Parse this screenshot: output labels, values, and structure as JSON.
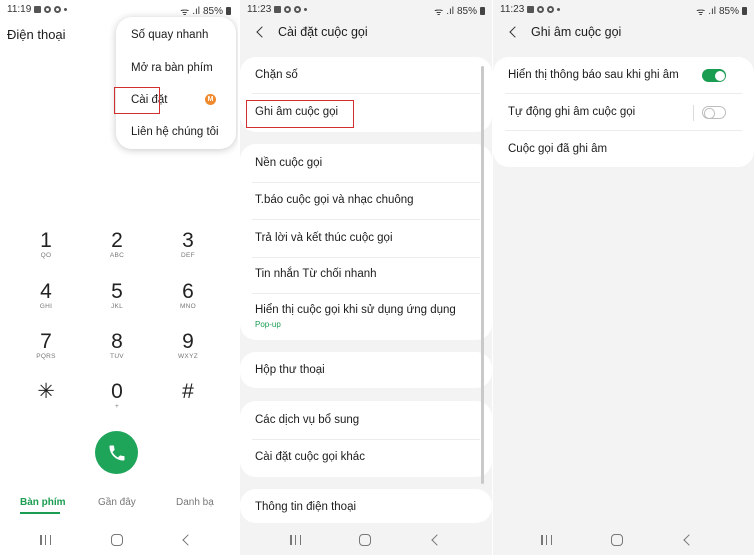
{
  "dialer": {
    "status": {
      "time": "11:19",
      "battery": "85%"
    },
    "title": "Điện thoại",
    "menu": {
      "items": [
        "Số quay nhanh",
        "Mở ra bàn phím",
        "Cài đặt",
        "Liên hệ chúng tôi"
      ],
      "badge": "M",
      "highlighted": "Cài đặt"
    },
    "keypad": [
      {
        "digit": "1",
        "letters": "QO"
      },
      {
        "digit": "2",
        "letters": "ABC"
      },
      {
        "digit": "3",
        "letters": "DEF"
      },
      {
        "digit": "4",
        "letters": "GHI"
      },
      {
        "digit": "5",
        "letters": "JKL"
      },
      {
        "digit": "6",
        "letters": "MNO"
      },
      {
        "digit": "7",
        "letters": "PQRS"
      },
      {
        "digit": "8",
        "letters": "TUV"
      },
      {
        "digit": "9",
        "letters": "WXYZ"
      },
      {
        "digit": "✳",
        "letters": ""
      },
      {
        "digit": "0",
        "letters": "+"
      },
      {
        "digit": "#",
        "letters": ""
      }
    ],
    "tabs": [
      "Bàn phím",
      "Gần đây",
      "Danh bạ"
    ],
    "active_tab": "Bàn phím"
  },
  "call_settings": {
    "status": {
      "time": "11:23",
      "battery": "85%"
    },
    "title": "Cài đặt cuộc gọi",
    "groups": [
      [
        "Chặn số",
        "Ghi âm cuộc gọi"
      ],
      [
        "Nền cuộc gọi",
        "T.báo cuộc gọi và nhạc chuông",
        "Trả lời và kết thúc cuộc gọi",
        "Tin nhắn Từ chối nhanh",
        "Hiển thị cuộc gọi khi sử dụng ứng dụng"
      ],
      [
        "Hộp thư thoại"
      ],
      [
        "Các dịch vụ bổ sung",
        "Cài đặt cuộc gọi khác"
      ],
      [
        "Thông tin điện thoại"
      ]
    ],
    "popup_sub": "Pop-up",
    "highlighted": "Ghi âm cuộc gọi"
  },
  "recording": {
    "status": {
      "time": "11:23",
      "battery": "85%"
    },
    "title": "Ghi âm cuộc gọi",
    "items": [
      {
        "label": "Hiển thị thông báo sau khi ghi âm",
        "toggle": "on"
      },
      {
        "label": "Tự động ghi âm cuộc gọi",
        "toggle": "off"
      },
      {
        "label": "Cuộc gọi đã ghi âm",
        "toggle": "none"
      }
    ]
  },
  "colors": {
    "accent": "#1a9c51",
    "call_button": "#1fa55a",
    "highlight": "#d32f2f",
    "badge": "#f08a2e"
  }
}
